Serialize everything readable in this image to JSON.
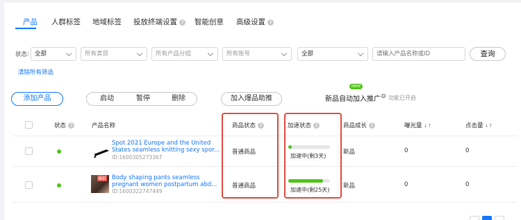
{
  "tabs": [
    {
      "label": "产品"
    },
    {
      "label": "人群标签"
    },
    {
      "label": "地域标签"
    },
    {
      "label": "投放终端设置",
      "help": "?"
    },
    {
      "label": "智能创意"
    },
    {
      "label": "高级设置",
      "help": "?"
    }
  ],
  "filters": {
    "status_label": "状态:",
    "status_value": "全部",
    "category_placeholder": "所有类目",
    "group_placeholder": "所有产品分组",
    "account_placeholder": "所有账号",
    "scope_value": "全部",
    "search_placeholder": "请输入产品名称或ID",
    "query_button": "查询",
    "clear_link": "清除所有筛选"
  },
  "actions": {
    "add_product": "添加产品",
    "start": "启动",
    "pause": "暂停",
    "delete": "删除",
    "boost": "加入爆品助推",
    "auto_join_label": "新品自动加入推广",
    "new_badge": "NEW",
    "auto_join_status": "功能已开启"
  },
  "table": {
    "headers": {
      "status": "状态",
      "name": "产品名称",
      "goods_status": "商品状态",
      "boost_status": "加速状态",
      "growth": "商品成长",
      "exposure": "曝光量",
      "clicks": "点击量"
    },
    "rows": [
      {
        "name_line1": "Spot 2021 Europe and the United",
        "name_line2": "States seamless knitting sexy spor...",
        "id": "ID:1600305273367",
        "goods_status": "普通商品",
        "boost_text": "加速中(剩3天)",
        "boost_progress": 0.08,
        "growth": "新品",
        "exposure": "0",
        "clicks": "0",
        "status_color": "#52c41a"
      },
      {
        "name_line1": "Body shaping pants seamless",
        "name_line2": "pregnant women postpartum abd...",
        "id": "ID:1600322747449",
        "goods_status": "普通商品",
        "boost_text": "加速中(剩25天)",
        "boost_progress": 0.83,
        "growth": "新品",
        "exposure": "0",
        "clicks": "0",
        "status_color": "#52c41a",
        "thumb_label": "爆款"
      }
    ]
  },
  "colors": {
    "accent": "#1677ff",
    "highlight_box": "#e34d42",
    "success": "#52c41a"
  }
}
